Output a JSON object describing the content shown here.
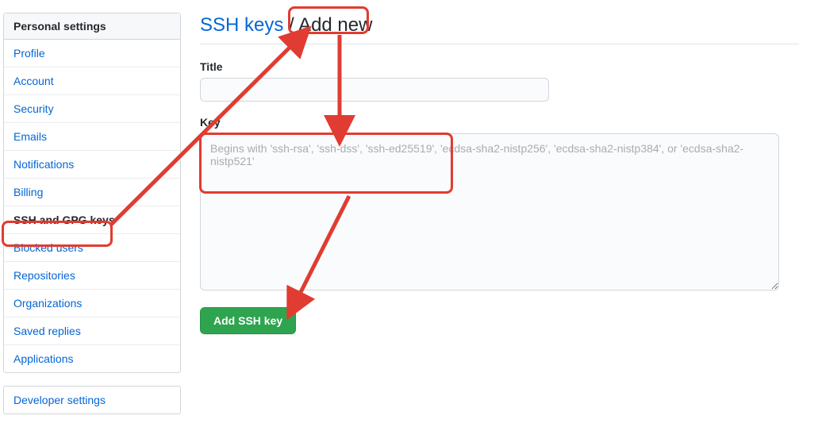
{
  "sidebar": {
    "header": "Personal settings",
    "items": [
      {
        "label": "Profile"
      },
      {
        "label": "Account"
      },
      {
        "label": "Security"
      },
      {
        "label": "Emails"
      },
      {
        "label": "Notifications"
      },
      {
        "label": "Billing"
      },
      {
        "label": "SSH and GPG keys"
      },
      {
        "label": "Blocked users"
      },
      {
        "label": "Repositories"
      },
      {
        "label": "Organizations"
      },
      {
        "label": "Saved replies"
      },
      {
        "label": "Applications"
      }
    ],
    "dev_header": "Developer settings"
  },
  "page": {
    "breadcrumb_link": "SSH keys",
    "breadcrumb_sep": " / ",
    "breadcrumb_current": "Add new"
  },
  "form": {
    "title_label": "Title",
    "title_value": "",
    "key_label": "Key",
    "key_placeholder": "Begins with 'ssh-rsa', 'ssh-dss', 'ssh-ed25519', 'ecdsa-sha2-nistp256', 'ecdsa-sha2-nistp384', or 'ecdsa-sha2-nistp521'",
    "submit_label": "Add SSH key"
  }
}
